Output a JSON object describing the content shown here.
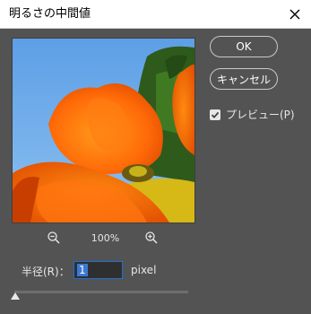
{
  "window": {
    "title": "明るさの中間値"
  },
  "buttons": {
    "ok_label": "OK",
    "cancel_label": "キャンセル"
  },
  "preview_option": {
    "label": "プレビュー(P)",
    "checked": true
  },
  "zoom": {
    "level": "100%"
  },
  "radius": {
    "label": "半径(R)：",
    "value": "1",
    "unit": "pixel",
    "slider_value": 1
  },
  "colors": {
    "dialog_bg": "#535353",
    "accent": "#1e6fd9"
  },
  "icons": {
    "zoom_out": "zoom-out-icon",
    "zoom_in": "zoom-in-icon",
    "close": "close-icon"
  }
}
